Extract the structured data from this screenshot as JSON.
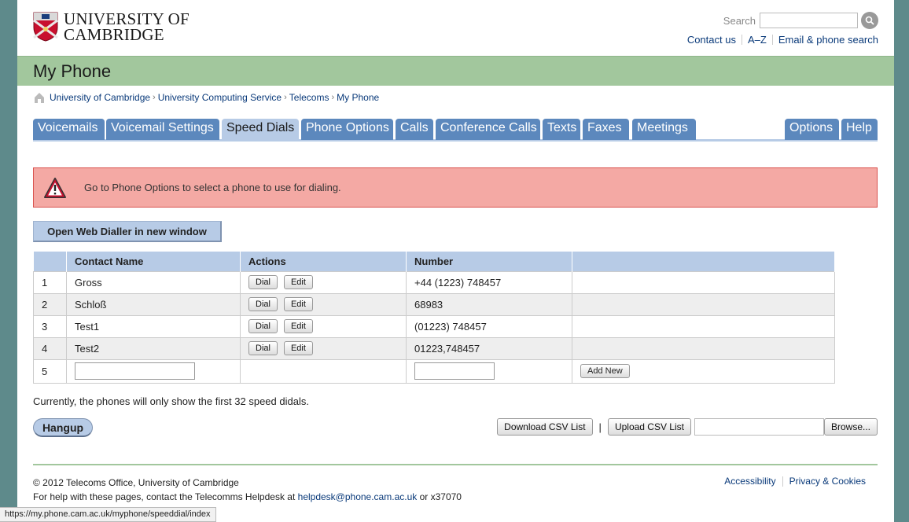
{
  "header": {
    "logo_line1": "UNIVERSITY OF",
    "logo_line2": "CAMBRIDGE",
    "search_label": "Search",
    "links": [
      "Contact us",
      "A–Z",
      "Email & phone search"
    ]
  },
  "page_title": "My Phone",
  "breadcrumb": [
    "University of Cambridge",
    "University Computing Service",
    "Telecoms",
    "My Phone"
  ],
  "tabs": [
    {
      "label": "Voicemails",
      "active": false
    },
    {
      "label": "Voicemail Settings",
      "active": false
    },
    {
      "label": "Speed Dials",
      "active": true
    },
    {
      "label": "Phone Options",
      "active": false
    },
    {
      "label": "Calls",
      "active": false
    },
    {
      "label": "Conference Calls",
      "active": false
    },
    {
      "label": "Texts",
      "active": false
    },
    {
      "label": "Faxes",
      "active": false
    },
    {
      "label": "Meetings",
      "active": false
    }
  ],
  "right_tabs": [
    "Options",
    "Help"
  ],
  "alert": "Go to Phone Options to select a phone to use for dialing.",
  "web_dialler_button": "Open Web Dialler in new window",
  "table": {
    "headers": [
      "",
      "Contact Name",
      "Actions",
      "Number",
      ""
    ],
    "rows": [
      {
        "index": "1",
        "name": "Gross",
        "number": "+44 (1223) 748457"
      },
      {
        "index": "2",
        "name": "Schloß",
        "number": "68983"
      },
      {
        "index": "3",
        "name": "Test1",
        "number": "(01223) 748457"
      },
      {
        "index": "4",
        "name": "Test2",
        "number": "01223,748457"
      }
    ],
    "dial_label": "Dial",
    "edit_label": "Edit",
    "new_row_index": "5",
    "add_new_label": "Add New"
  },
  "note": "Currently, the phones will only show the first 32 speed didals.",
  "hangup_label": "Hangup",
  "csv": {
    "download_label": "Download CSV List",
    "separator": "|",
    "upload_label": "Upload CSV List",
    "browse_label": "Browse..."
  },
  "footer": {
    "copyright": "© 2012 Telecoms Office, University of Cambridge",
    "help_text": "For help with these pages, contact the Telecomms Helpdesk at",
    "help_email": "helpdesk@phone.cam.ac.uk",
    "help_suffix": "or x37070",
    "links": [
      "Accessibility",
      "Privacy & Cookies"
    ]
  },
  "status_url": "https://my.phone.cam.ac.uk/myphone/speeddial/index",
  "colors": {
    "title_bar": "#a2c79d",
    "tab": "#5c88bd",
    "tab_active": "#b7cbe6",
    "alert_bg": "#f4a9a4",
    "link": "#0a3a7a"
  }
}
